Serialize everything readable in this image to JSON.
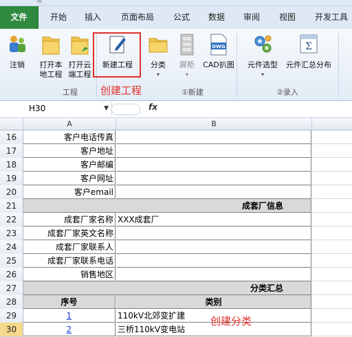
{
  "title_strip": {
    "zoom_fragment": "%"
  },
  "ribbon_tabs": [
    "文件",
    "开始",
    "插入",
    "页面布局",
    "公式",
    "数据",
    "审阅",
    "视图",
    "开发工具"
  ],
  "ribbon": {
    "buttons": {
      "logout": "注销",
      "open_local": [
        "打开本",
        "地工程"
      ],
      "open_cloud": [
        "打开云",
        "端工程"
      ],
      "new_project": "新建工程",
      "category": "分类",
      "cabinet": "屏柜",
      "cad_extract": "CAD扒图",
      "component_select": "元件选型",
      "component_summary": "元件汇总分布"
    },
    "dwg_label": "DWG",
    "groups": {
      "project": "工程",
      "new": "①新建",
      "entry": "②录入"
    },
    "annotation": "创建工程"
  },
  "formula_bar": {
    "cell_ref": "H30",
    "fx": "fx",
    "value": ""
  },
  "columns": [
    "A",
    "B"
  ],
  "rows": [
    {
      "num": "16",
      "a": "客户电话传真",
      "b": ""
    },
    {
      "num": "17",
      "a": "客户地址",
      "b": ""
    },
    {
      "num": "18",
      "a": "客户邮编",
      "b": ""
    },
    {
      "num": "19",
      "a": "客户网址",
      "b": ""
    },
    {
      "num": "20",
      "a": "客户email",
      "b": ""
    },
    {
      "num": "21",
      "section": "成套厂信息"
    },
    {
      "num": "22",
      "a": "成套厂家名称",
      "b": "XXX成套厂"
    },
    {
      "num": "23",
      "a": "成套厂家英文名称",
      "b": ""
    },
    {
      "num": "24",
      "a": "成套厂家联系人",
      "b": ""
    },
    {
      "num": "25",
      "a": "成套厂家联系电话",
      "b": ""
    },
    {
      "num": "26",
      "a": "销售地区",
      "b": ""
    },
    {
      "num": "27",
      "section": "分类汇总"
    },
    {
      "num": "28",
      "header": true,
      "a": "序号",
      "b": "类别"
    },
    {
      "num": "29",
      "link": true,
      "a": "1",
      "b": "110kV北郊变扩建"
    },
    {
      "num": "30",
      "link": true,
      "selected": true,
      "a": "2",
      "b": "三桥110kV变电站"
    }
  ],
  "sheet_annotation": "创建分类",
  "colors": {
    "file_tab": "#2f8a3f",
    "annotation": "#e0302a",
    "section_fill": "#d9d9d9",
    "link": "#1f3fd0",
    "selected_row": "#f5d88a"
  }
}
